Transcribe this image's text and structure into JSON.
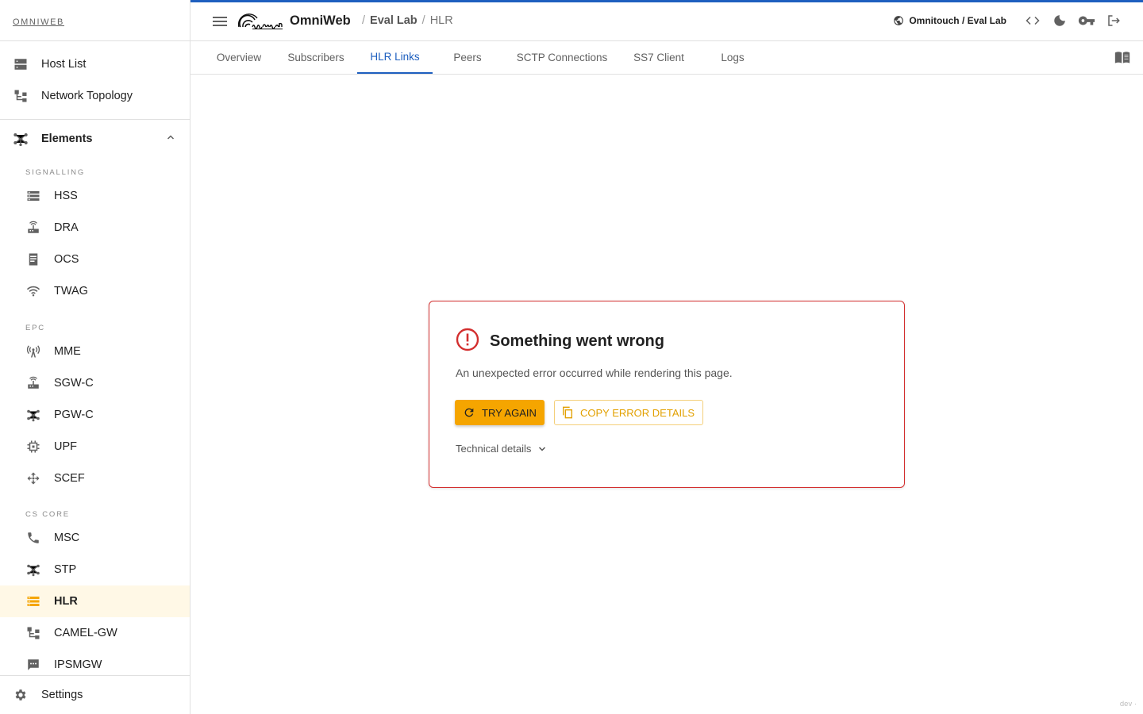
{
  "sidebar": {
    "brand": "OMNIWEB",
    "top_items": [
      {
        "label": "Host List",
        "icon": "host-list-icon"
      },
      {
        "label": "Network Topology",
        "icon": "network-topology-icon"
      }
    ],
    "elements_label": "Elements",
    "groups": {
      "signalling": "SIGNALLING",
      "epc": "EPC",
      "cs_core": "CS CORE"
    },
    "signalling_items": [
      {
        "label": "HSS"
      },
      {
        "label": "DRA"
      },
      {
        "label": "OCS"
      },
      {
        "label": "TWAG"
      }
    ],
    "epc_items": [
      {
        "label": "MME"
      },
      {
        "label": "SGW-C"
      },
      {
        "label": "PGW-C"
      },
      {
        "label": "UPF"
      },
      {
        "label": "SCEF"
      }
    ],
    "cs_items": [
      {
        "label": "MSC"
      },
      {
        "label": "STP"
      },
      {
        "label": "HLR"
      },
      {
        "label": "CAMEL-GW"
      },
      {
        "label": "IPSMGW"
      }
    ],
    "active_item": "HLR",
    "settings_label": "Settings"
  },
  "header": {
    "app_name": "OmniWeb",
    "breadcrumbs": [
      "Eval Lab",
      "HLR"
    ],
    "separator": "/",
    "org_label": "Omnitouch / Eval Lab",
    "accent_color": "#1e5fbf"
  },
  "tabs": [
    "Overview",
    "Subscribers",
    "HLR Links",
    "Peers",
    "SCTP Connections",
    "SS7 Client",
    "Logs"
  ],
  "active_tab": "HLR Links",
  "error": {
    "title": "Something went wrong",
    "message": "An unexpected error occurred while rendering this page.",
    "try_again": "TRY AGAIN",
    "copy_details": "COPY ERROR DETAILS",
    "technical_details": "Technical details",
    "border_color": "#d32f2f",
    "button_color": "#f5a500"
  },
  "env_label": "dev ·"
}
